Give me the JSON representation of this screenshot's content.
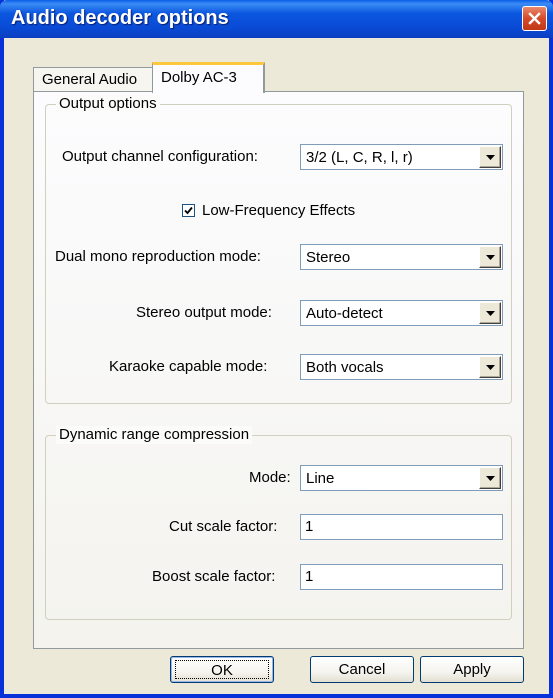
{
  "window": {
    "title": "Audio decoder options"
  },
  "tabs": [
    {
      "label": "General Audio",
      "active": false
    },
    {
      "label": "Dolby AC-3",
      "active": true
    }
  ],
  "output_options": {
    "group_title": "Output options",
    "channel_config": {
      "label": "Output channel configuration:",
      "value": "3/2 (L, C, R, l, r)"
    },
    "lfe": {
      "label": "Low-Frequency Effects",
      "checked": true
    },
    "dual_mono": {
      "label": "Dual mono reproduction mode:",
      "value": "Stereo"
    },
    "stereo_output": {
      "label": "Stereo output mode:",
      "value": "Auto-detect"
    },
    "karaoke": {
      "label": "Karaoke capable mode:",
      "value": "Both vocals"
    }
  },
  "drc": {
    "group_title": "Dynamic range compression",
    "mode": {
      "label": "Mode:",
      "value": "Line"
    },
    "cut": {
      "label": "Cut scale factor:",
      "value": "1"
    },
    "boost": {
      "label": "Boost scale factor:",
      "value": "1"
    }
  },
  "buttons": {
    "ok": "OK",
    "cancel": "Cancel",
    "apply": "Apply"
  },
  "icons": {
    "close": "close-icon",
    "dropdown": "dropdown-arrow-icon",
    "check": "checkmark-icon"
  }
}
